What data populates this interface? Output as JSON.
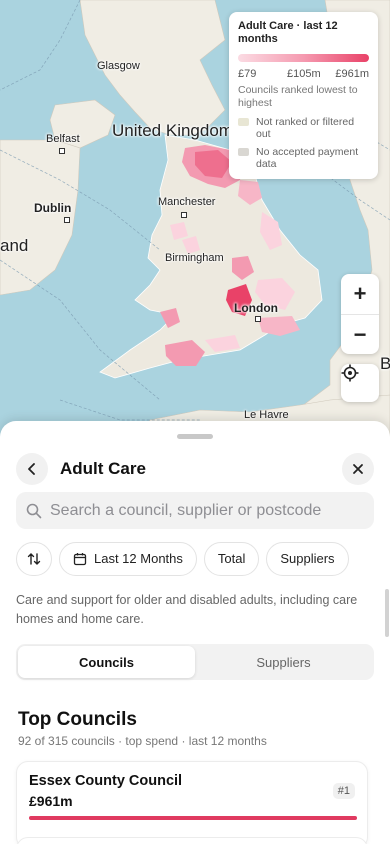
{
  "map": {
    "labels": {
      "uk": "United Kingdom",
      "ireland_partial": "and",
      "glasgow": "Glasgow",
      "belfast": "Belfast",
      "dublin": "Dublin",
      "manchester": "Manchester",
      "birmingham": "Birmingham",
      "london": "London",
      "le_havre": "Le Havre",
      "edge_letter": "B"
    },
    "colors": {
      "sea": "#aad3df",
      "land": "#f0ede4",
      "england": "#ede9df",
      "high": "#e94268",
      "mid": "#f39ab1",
      "low": "#fbd3de"
    }
  },
  "legend": {
    "title": "Adult Care · last 12 months",
    "min": "£79",
    "mid": "£105m",
    "max": "£961m",
    "note": "Councils ranked lowest to highest",
    "items": [
      {
        "label": "Not ranked or filtered out",
        "color": "#e8e6d4"
      },
      {
        "label": "No accepted payment data",
        "color": "#d9d7d2"
      }
    ]
  },
  "controls": {
    "zoom_in": "+",
    "zoom_out": "−"
  },
  "sheet": {
    "title": "Adult Care",
    "search_placeholder": "Search a council, supplier or postcode",
    "filters": [
      "Last 12 Months",
      "Total",
      "Suppliers"
    ],
    "description": "Care and support for older and disabled adults, including care homes and home care.",
    "tabs": [
      "Councils",
      "Suppliers"
    ],
    "active_tab": "Councils",
    "section_title": "Top Councils",
    "section_sub": "92 of 315 councils · top spend · last 12 months",
    "top": [
      {
        "name": "Essex County Council",
        "amount": "£961m",
        "rank": "#1",
        "share": 1.0
      }
    ]
  }
}
